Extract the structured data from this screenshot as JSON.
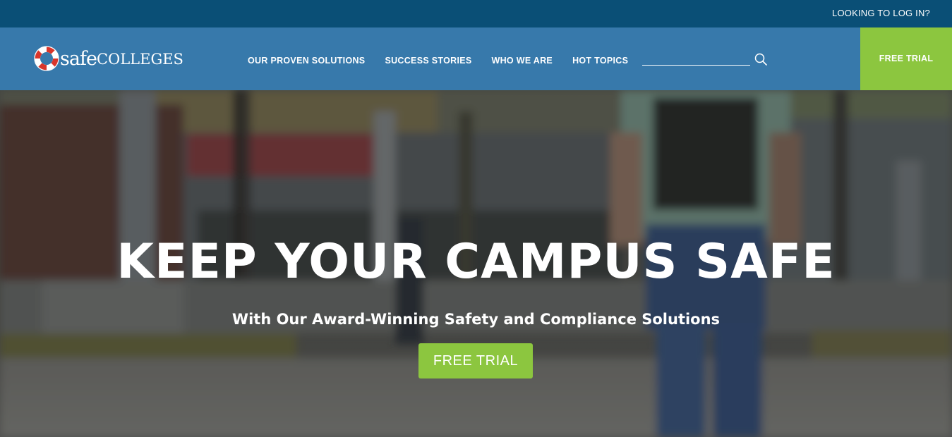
{
  "topbar": {
    "login_label": "LOOKING TO LOG IN?"
  },
  "header": {
    "logo": {
      "part_safe": "safe",
      "part_colleges": "COLLEGES"
    },
    "nav": [
      {
        "label": "OUR PROVEN SOLUTIONS"
      },
      {
        "label": "SUCCESS STORIES"
      },
      {
        "label": "WHO WE ARE"
      },
      {
        "label": "HOT TOPICS"
      }
    ],
    "search": {
      "value": "",
      "icon": "search-icon"
    },
    "trial_label": "FREE TRIAL"
  },
  "hero": {
    "title": "KEEP YOUR CAMPUS SAFE",
    "subtitle": "With Our Award-Winning Safety and Compliance Solutions",
    "cta_label": "FREE TRIAL"
  },
  "colors": {
    "topbar": "#0a4f76",
    "header": "#3779ab",
    "accent_green": "#8cc63f",
    "text": "#ffffff"
  }
}
